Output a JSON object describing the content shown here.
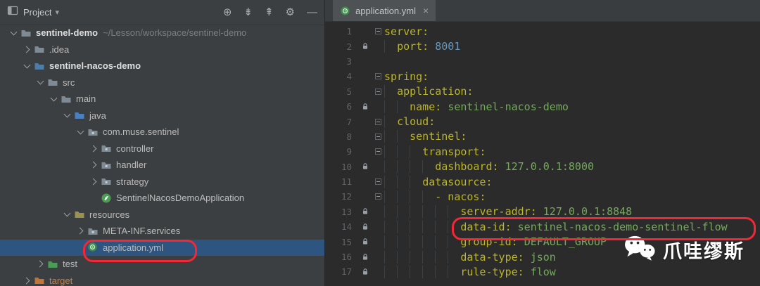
{
  "colors": {
    "annotation_red": "#F32735",
    "panel_bg": "#3C3F41",
    "editor_bg": "#2B2B2B",
    "selection_bg": "#2E5480",
    "yaml_key": "#BBB529",
    "yaml_value": "#74A95C",
    "yaml_number": "#6897BB",
    "line_number_gray": "#606366",
    "excluded_orange": "#C87E41"
  },
  "project_panel": {
    "title": "Project",
    "dropdown_caret": "▾",
    "toolbar": [
      {
        "name": "locate-file-icon",
        "glyph": "⊕"
      },
      {
        "name": "expand-all-icon",
        "glyph": "⇟"
      },
      {
        "name": "collapse-all-icon",
        "glyph": "⇞"
      },
      {
        "name": "settings-gear-icon",
        "glyph": "⚙"
      },
      {
        "name": "hide-panel-icon",
        "glyph": "—"
      }
    ],
    "tree": [
      {
        "label": "sentinel-demo",
        "suffix": "~/Lesson/workspace/sentinel-demo",
        "level": 0,
        "chevron": "expanded",
        "icon": "project-folder",
        "bold": true
      },
      {
        "label": ".idea",
        "level": 1,
        "chevron": "collapsed",
        "icon": "folder"
      },
      {
        "label": "sentinel-nacos-demo",
        "level": 1,
        "chevron": "expanded",
        "icon": "module-folder",
        "bold": true
      },
      {
        "label": "src",
        "level": 2,
        "chevron": "expanded",
        "icon": "folder"
      },
      {
        "label": "main",
        "level": 3,
        "chevron": "expanded",
        "icon": "folder"
      },
      {
        "label": "java",
        "level": 4,
        "chevron": "expanded",
        "icon": "source-folder"
      },
      {
        "label": "com.muse.sentinel",
        "level": 5,
        "chevron": "expanded",
        "icon": "package"
      },
      {
        "label": "controller",
        "level": 6,
        "chevron": "collapsed",
        "icon": "package"
      },
      {
        "label": "handler",
        "level": 6,
        "chevron": "collapsed",
        "icon": "package"
      },
      {
        "label": "strategy",
        "level": 6,
        "chevron": "collapsed",
        "icon": "package"
      },
      {
        "label": "SentinelNacosDemoApplication",
        "level": 6,
        "chevron": null,
        "icon": "boot-class"
      },
      {
        "label": "resources",
        "level": 4,
        "chevron": "expanded",
        "icon": "resources-folder"
      },
      {
        "label": "META-INF.services",
        "level": 5,
        "chevron": "collapsed",
        "icon": "package"
      },
      {
        "label": "application.yml",
        "level": 5,
        "chevron": null,
        "icon": "yaml-file",
        "selected": true
      },
      {
        "label": "test",
        "level": 2,
        "chevron": "collapsed",
        "icon": "test-folder"
      },
      {
        "label": "target",
        "level": 1,
        "chevron": "collapsed",
        "icon": "excluded-folder",
        "muted": "orange"
      }
    ]
  },
  "editor": {
    "tab": {
      "label": "application.yml",
      "close": "×",
      "icon": "yaml-file"
    },
    "lines": [
      {
        "n": 1,
        "fold": true,
        "icon": false,
        "tokens": [
          [
            "k",
            "server:"
          ]
        ]
      },
      {
        "n": 2,
        "fold": false,
        "icon": true,
        "tokens": [
          [
            "i",
            "  "
          ],
          [
            "k",
            "port:"
          ],
          [
            "p",
            " "
          ],
          [
            "n",
            "8001"
          ]
        ]
      },
      {
        "n": 3,
        "fold": false,
        "icon": false,
        "tokens": []
      },
      {
        "n": 4,
        "fold": true,
        "icon": false,
        "tokens": [
          [
            "k",
            "spring:"
          ]
        ]
      },
      {
        "n": 5,
        "fold": true,
        "icon": false,
        "tokens": [
          [
            "i",
            "  "
          ],
          [
            "k",
            "application:"
          ]
        ]
      },
      {
        "n": 6,
        "fold": false,
        "icon": true,
        "tokens": [
          [
            "i",
            "    "
          ],
          [
            "k",
            "name:"
          ],
          [
            "p",
            " "
          ],
          [
            "v",
            "sentinel-nacos-demo"
          ]
        ]
      },
      {
        "n": 7,
        "fold": true,
        "icon": false,
        "tokens": [
          [
            "i",
            "  "
          ],
          [
            "k",
            "cloud:"
          ]
        ]
      },
      {
        "n": 8,
        "fold": true,
        "icon": false,
        "tokens": [
          [
            "i",
            "    "
          ],
          [
            "k",
            "sentinel:"
          ]
        ]
      },
      {
        "n": 9,
        "fold": true,
        "icon": false,
        "tokens": [
          [
            "i",
            "      "
          ],
          [
            "k",
            "transport:"
          ]
        ]
      },
      {
        "n": 10,
        "fold": false,
        "icon": true,
        "tokens": [
          [
            "i",
            "        "
          ],
          [
            "k",
            "dashboard:"
          ],
          [
            "p",
            " "
          ],
          [
            "v",
            "127.0.0.1:8000"
          ]
        ]
      },
      {
        "n": 11,
        "fold": true,
        "icon": false,
        "tokens": [
          [
            "i",
            "      "
          ],
          [
            "k",
            "datasource:"
          ]
        ]
      },
      {
        "n": 12,
        "fold": true,
        "icon": false,
        "tokens": [
          [
            "i",
            "        "
          ],
          [
            "k",
            "- nacos:"
          ]
        ]
      },
      {
        "n": 13,
        "fold": false,
        "icon": true,
        "tokens": [
          [
            "i",
            "            "
          ],
          [
            "k",
            "server-addr:"
          ],
          [
            "p",
            " "
          ],
          [
            "v",
            "127.0.0.1:8848"
          ]
        ]
      },
      {
        "n": 14,
        "fold": false,
        "icon": true,
        "annotated": true,
        "tokens": [
          [
            "i",
            "            "
          ],
          [
            "k",
            "data-id:"
          ],
          [
            "p",
            " "
          ],
          [
            "v",
            "sentinel-nacos-demo-sentinel-flow"
          ]
        ]
      },
      {
        "n": 15,
        "fold": false,
        "icon": true,
        "tokens": [
          [
            "i",
            "            "
          ],
          [
            "k",
            "group-id:"
          ],
          [
            "p",
            " "
          ],
          [
            "v",
            "DEFAULT_GROUP"
          ]
        ]
      },
      {
        "n": 16,
        "fold": false,
        "icon": true,
        "tokens": [
          [
            "i",
            "            "
          ],
          [
            "k",
            "data-type:"
          ],
          [
            "p",
            " "
          ],
          [
            "v",
            "json"
          ]
        ]
      },
      {
        "n": 17,
        "fold": false,
        "icon": true,
        "tokens": [
          [
            "i",
            "            "
          ],
          [
            "k",
            "rule-type:"
          ],
          [
            "p",
            " "
          ],
          [
            "v",
            "flow"
          ]
        ]
      }
    ]
  },
  "watermark": {
    "text": "爪哇缪斯"
  }
}
